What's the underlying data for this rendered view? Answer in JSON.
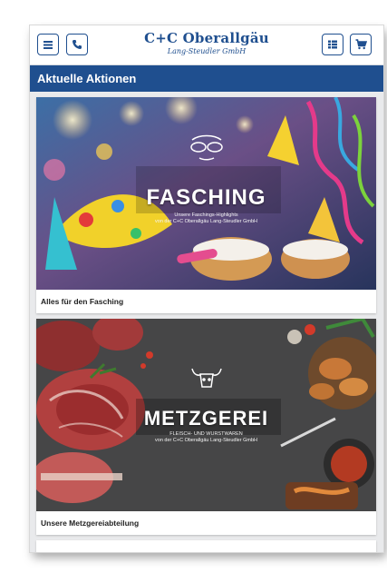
{
  "header": {
    "logo_line1": "C+C Oberallgäu",
    "logo_line2": "Lang-Steudler GmbH",
    "left_buttons": [
      {
        "icon": "menu-icon"
      },
      {
        "icon": "phone-icon"
      }
    ],
    "right_buttons": [
      {
        "icon": "list-icon"
      },
      {
        "icon": "cart-icon"
      }
    ]
  },
  "section": {
    "title": "Aktuelle Aktionen"
  },
  "promotions": [
    {
      "title": "FASCHING",
      "subtitle_1": "Unsere Faschings-Highlights",
      "subtitle_2": "von der C+C Oberallgäu Lang-Steudler GmbH",
      "caption": "Alles für den Fasching"
    },
    {
      "title": "METZGEREI",
      "subtitle_1": "FLEISCH- UND WURSTWAREN",
      "subtitle_2": "von der C+C Oberallgäu Lang-Steudler GmbH",
      "caption": "Unsere Metzgereiabteilung"
    }
  ],
  "colors": {
    "brand": "#1f4f8f",
    "background": "#e9eaec"
  }
}
